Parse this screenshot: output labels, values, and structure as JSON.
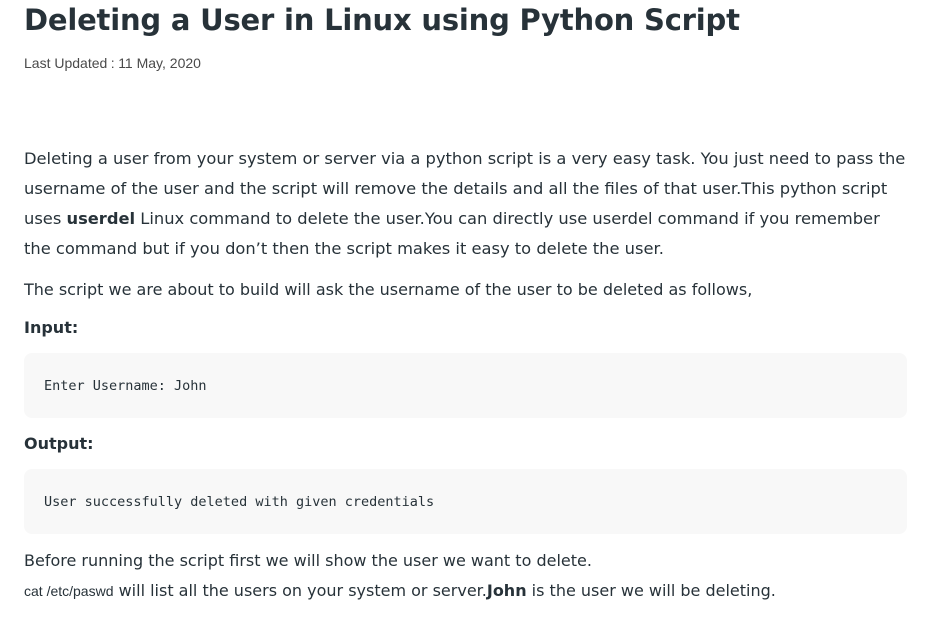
{
  "article": {
    "title": "Deleting a User in Linux using Python Script",
    "updated_label": "Last Updated",
    "updated_sep": ":",
    "updated_date": "11 May, 2020",
    "intro": {
      "part1": "Deleting a user from your system or server via a python script is a very easy task. You just need to pass the username of the user and the script will remove the details and all the files of that user.This python script uses ",
      "bold": "userdel",
      "part2": " Linux command to delete the user.You can directly use userdel command if you remember the command but if you don’t then the script makes it easy to delete the user."
    },
    "script_intro": "The script we are about to build will ask the username of the user to be deleted as follows,",
    "input_label": "Input:",
    "input_code": "Enter Username: John",
    "output_label": "Output:",
    "output_code": "User successfully deleted with given credentials",
    "before_running": "Before running the script first we will show the user we want to delete.",
    "cat_cmd": "cat /etc/paswd",
    "cat_text": " will list all the users on your system or server.",
    "john_bold": "John",
    "john_text": " is the user we will be deleting."
  }
}
